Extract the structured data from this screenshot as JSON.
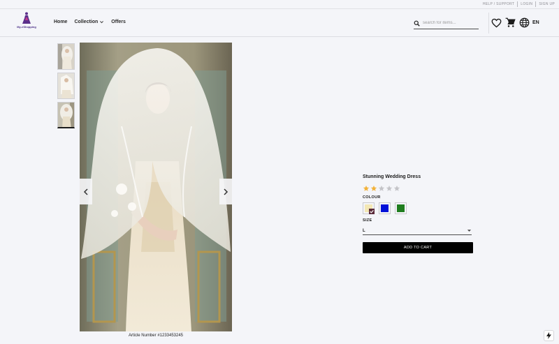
{
  "topbar": {
    "links": [
      "HELP / SUPPORT",
      "LOGIN",
      "SIGN UP"
    ]
  },
  "header": {
    "logo_text": "My-eShopping",
    "nav": {
      "home": "Home",
      "collection": "Collection",
      "offers": "Offers"
    },
    "search_placeholder": "search for items...",
    "language": "EN"
  },
  "product": {
    "title": "Stunning Wedding Dress",
    "rating": 2,
    "rating_max": 5,
    "colour_label": "COLOUR",
    "colours": [
      "#f3e7b4",
      "#0010d8",
      "#1f7d1f"
    ],
    "selected_colour_index": 0,
    "size_label": "SIZE",
    "size_value": "L",
    "add_to_cart": "ADD TO CART",
    "article_number": "Article Number #1233453245"
  },
  "gallery": {
    "thumbnail_count": 3,
    "active_thumbnail": 2
  },
  "colors": {
    "star_filled": "#f2b23a",
    "star_empty": "#c4c4c8",
    "cart_bg": "#000000"
  }
}
